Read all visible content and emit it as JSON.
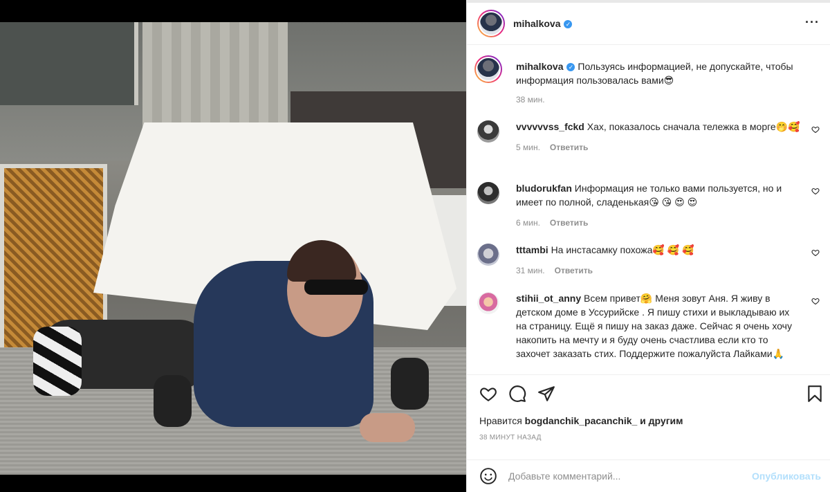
{
  "post": {
    "username": "mihalkova",
    "caption": "Пользуясь информацией, не допускайте, чтобы информация пользовалась вами😎",
    "caption_time": "38 мин."
  },
  "comments": [
    {
      "username": "vvvvvvss_fckd",
      "text": "Хах, показалось сначала тележка в морге🤭🥰",
      "time": "5 мин.",
      "reply": "Ответить"
    },
    {
      "username": "bludorukfan",
      "text": "Информация не только вами пользуется, но и имеет по полной, сладенькая😘 😘 😍 😍",
      "time": "6 мин.",
      "reply": "Ответить"
    },
    {
      "username": "tttambi",
      "text": "На инстасамку похожа🥰 🥰 🥰",
      "time": "31 мин.",
      "reply": "Ответить"
    },
    {
      "username": "stihii_ot_anny",
      "text": "Всем привет🤗 Меня зовут Аня. Я живу в детском доме в Уссурийске . Я пишу стихи и выкладываю их на страницу. Ещё я пишу на заказ даже. Сейчас я очень хочу накопить на мечту и я буду очень счастлива если кто то захочет заказать стих. Поддержите пожалуйста Лайками🙏"
    }
  ],
  "likes": {
    "prefix": "Нравится",
    "user": "bogdanchik_pacanchik_",
    "suffix": "и другим"
  },
  "time_ago": "38 МИНУТ НАЗАД",
  "add_comment": {
    "placeholder": "Добавьте комментарий...",
    "publish": "Опубликовать"
  },
  "icons": {
    "verified": "verified-badge-icon",
    "more": "more-options-icon",
    "like": "heart-icon",
    "comment": "comment-bubble-icon",
    "share": "send-icon",
    "save": "bookmark-icon",
    "emoji": "emoji-icon"
  },
  "colors": {
    "verified": "#3897f0",
    "publish_disabled": "#b2dffc",
    "meta": "#8e8e8e"
  }
}
